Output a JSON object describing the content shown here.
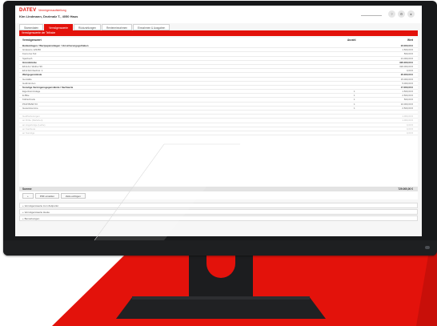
{
  "colors": {
    "brand_red": "#e3120b",
    "monitor": "#17181a",
    "screen_bg": "#f6f6f6"
  },
  "app": {
    "logo_text": "DATEV",
    "title": "Vermögensaufstellung",
    "client": "Kim Lindmann, Dezimalz T., 4050 Haus"
  },
  "header": {
    "search_placeholder": "",
    "buttons": [
      {
        "icon": "question-icon",
        "label": "?"
      },
      {
        "icon": "gear-icon",
        "label": "⚙"
      },
      {
        "icon": "user-icon",
        "label": "●"
      }
    ]
  },
  "tabs": [
    {
      "label": "Stammdaten",
      "active": false
    },
    {
      "label": "Vermögenswerte",
      "active": true
    },
    {
      "label": "Rückzahlungen",
      "active": false
    },
    {
      "label": "Renteneinnahmen",
      "active": false
    },
    {
      "label": "Einnahmen & Ausgaben",
      "active": false
    }
  ],
  "section_title": "Vermögenswerte der Teilhabe",
  "table": {
    "col_name": "Vermögenswert",
    "col_qty": "Anzahl",
    "col_value": "Wert",
    "rows": [
      {
        "name": "Bankeinlagen / Wertpapieranlagen / Versicherungsguthaben",
        "qty": "",
        "value": "23.000,00 €",
        "style": "head"
      },
      {
        "name": "Girokonto 123456",
        "qty": "",
        "value": "1.500,00 €",
        "style": ""
      },
      {
        "name": "Konto bei Teil",
        "qty": "",
        "value": "500,00 €",
        "style": ""
      },
      {
        "name": "Sparbuch",
        "qty": "",
        "value": "21.000,00 €",
        "style": ""
      },
      {
        "name": "Grundstücke",
        "qty": "",
        "value": "320.000,00 €",
        "style": "head"
      },
      {
        "name": "EFH Am Weiher 99",
        "qty": "",
        "value": "320.000,00 €",
        "style": ""
      },
      {
        "name": "EFH Rohrbachstr. 1",
        "qty": "",
        "value": "0,00 €",
        "style": ""
      },
      {
        "name": "Wertgegenstände",
        "qty": "",
        "value": "20.000,00 €",
        "style": "head"
      },
      {
        "name": "Gemälde",
        "qty": "",
        "value": "15.000,00 €",
        "style": ""
      },
      {
        "name": "Goldmünzen",
        "qty": "",
        "value": "5.000,00 €",
        "style": ""
      },
      {
        "name": "Sonstige Vermögensgegenstände / Sachwerte",
        "qty": "",
        "value": "17.000,00 €",
        "style": "head"
      },
      {
        "name": "Eigenheimzulage",
        "qty": "1",
        "value": "1.500,00 €",
        "style": ""
      },
      {
        "name": "E-Bike",
        "qty": "1",
        "value": "2.500,00 €",
        "style": ""
      },
      {
        "name": "Kühlschrank",
        "qty": "1",
        "value": "500,00 €",
        "style": ""
      },
      {
        "name": "PKW BMW X3",
        "qty": "1",
        "value": "10.000,00 €",
        "style": ""
      },
      {
        "name": "Gesamtsumme",
        "qty": "1",
        "value": "2.500,00 €",
        "style": ""
      },
      {
        "name": "",
        "qty": "",
        "value": "",
        "style": "spacer"
      },
      {
        "name": "Geldforderungen",
        "qty": "",
        "value": "1.000,00 €",
        "style": "muted"
      },
      {
        "name": "an Dritte (Darlehen)",
        "qty": "",
        "value": "1.000,00 €",
        "style": "muted"
      },
      {
        "name": "an Angehörige (Leihe)",
        "qty": "",
        "value": "0,00 €",
        "style": "muted"
      },
      {
        "name": "an Kaufleute",
        "qty": "",
        "value": "0,00 €",
        "style": "muted"
      },
      {
        "name": "an Sonstige",
        "qty": "",
        "value": "0,00 €",
        "style": "muted"
      }
    ],
    "sum_label": "Summe",
    "sum_value": "729.000,00 €"
  },
  "actions": [
    {
      "icon": "plus-icon",
      "label": "+"
    },
    {
      "icon": "",
      "label": "PDF erstellen"
    },
    {
      "icon": "",
      "label": "Zeile einfügen"
    }
  ],
  "accordions": [
    "+ Vermögenswerte zum Zeitpunkt",
    "+ Vermögenswerte Heute",
    "+ Bemerkungen"
  ]
}
